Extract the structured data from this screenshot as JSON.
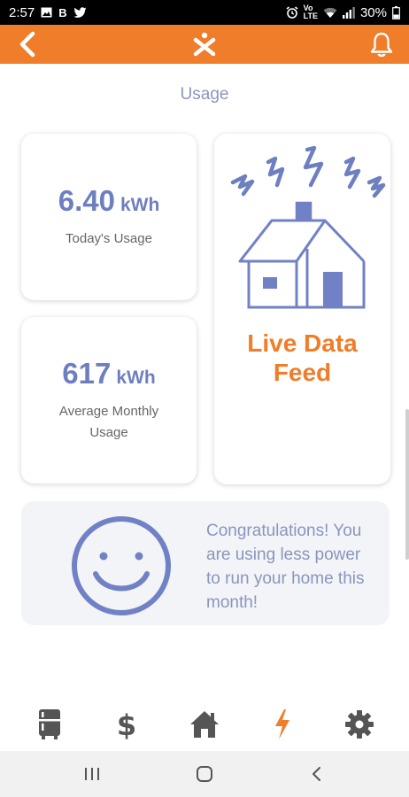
{
  "status_bar": {
    "time": "2:57",
    "left_icons": [
      "image-icon",
      "b-app-icon",
      "twitter-icon"
    ],
    "right_icons": [
      "alarm-icon",
      "volte-icon",
      "wifi-icon",
      "signal-icon"
    ],
    "battery": "30%"
  },
  "header": {
    "back_icon": "back-chevron-icon",
    "logo_icon": "app-logo-icon",
    "notification_icon": "bell-icon",
    "background": "#ef7d2a"
  },
  "page": {
    "title": "Usage"
  },
  "today_card": {
    "value": "6.40",
    "unit": "kWh",
    "label": "Today's Usage"
  },
  "monthly_card": {
    "value": "617",
    "unit": "kWh",
    "label": "Average Monthly Usage"
  },
  "live_card": {
    "icon": "house-lightning-icon",
    "title": "Live Data Feed"
  },
  "congrats": {
    "icon": "smiley-face-icon",
    "message": "Congratulations! You are using less power to run your home this month!"
  },
  "bottom_nav": [
    {
      "name": "appliance-icon",
      "active": false
    },
    {
      "name": "dollar-icon",
      "active": false
    },
    {
      "name": "home-icon",
      "active": false
    },
    {
      "name": "lightning-icon",
      "active": true
    },
    {
      "name": "gear-icon",
      "active": false
    }
  ],
  "colors": {
    "accent": "#ef7d2a",
    "stat_blue": "#6e7fbf",
    "soft_blue": "#8b95bd",
    "nav_gray": "#555555"
  },
  "system_nav": [
    "recents-icon",
    "home-circle-icon",
    "back-icon"
  ]
}
